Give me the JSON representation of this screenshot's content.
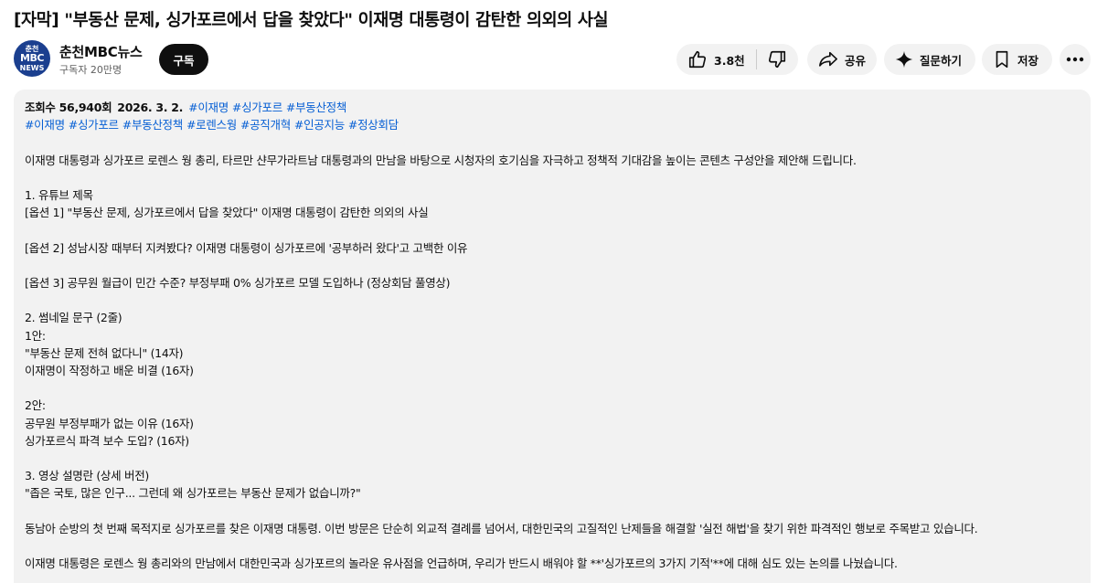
{
  "video": {
    "title": "[자막] \"부동산 문제, 싱가포르에서 답을 찾았다\" 이재명 대통령이 감탄한 의외의 사실"
  },
  "channel": {
    "avatar_top": "춘천",
    "avatar_mid": "MBC",
    "avatar_bottom": "NEWS",
    "name": "춘천MBC뉴스",
    "subscribers": "구독자 20만명",
    "subscribe_label": "구독"
  },
  "actions": {
    "like_count": "3.8천",
    "share_label": "공유",
    "ask_label": "질문하기",
    "save_label": "저장"
  },
  "description": {
    "views": "조회수 56,940회",
    "date": "2026. 3. 2.",
    "title_tags": [
      "#이재명",
      "#싱가포르",
      "#부동산정책"
    ],
    "tags": [
      "#이재명",
      "#싱가포르",
      "#부동산정책",
      "#로렌스웡",
      "#공직개혁",
      "#인공지능",
      "#정상회담"
    ],
    "lines": [
      "이재명 대통령과 싱가포르 로렌스 웡 총리, 타르만 샨무가라트남 대통령과의 만남을 바탕으로 시청자의 호기심을 자극하고 정책적 기대감을 높이는 콘텐츠 구성안을 제안해 드립니다.",
      "",
      "1. 유튜브 제목",
      "[옵션 1] \"부동산 문제, 싱가포르에서 답을 찾았다\" 이재명 대통령이 감탄한 의외의 사실",
      "",
      "[옵션 2] 성남시장 때부터 지켜봤다? 이재명 대통령이 싱가포르에 '공부하러 왔다'고 고백한 이유",
      "",
      "[옵션 3] 공무원 월급이 민간 수준? 부정부패 0% 싱가포르 모델 도입하나 (정상회담 풀영상)",
      "",
      "2. 썸네일 문구 (2줄)",
      "1안:",
      "\"부동산 문제 전혀 없다니\" (14자)",
      "이재명이 작정하고 배운 비결 (16자)",
      "",
      "2안:",
      "공무원 부정부패가 없는 이유 (16자)",
      "싱가포르식 파격 보수 도입? (16자)",
      "",
      "3. 영상 설명란 (상세 버전)",
      "\"좁은 국토, 많은 인구... 그런데 왜 싱가포르는 부동산 문제가 없습니까?\"",
      "",
      "동남아 순방의 첫 번째 목적지로 싱가포르를 찾은 이재명 대통령. 이번 방문은 단순히 외교적 결례를 넘어서, 대한민국의 고질적인 난제들을 해결할 '실전 해법'을 찾기 위한 파격적인 행보로 주목받고 있습니다.",
      "",
      "이재명 대통령은 로렌스 웡 총리와의 만남에서 대한민국과 싱가포르의 놀라운 유사점을 언급하며, 우리가 반드시 배워야 할 **'싱가포르의 3가지 기적'**에 대해 심도 있는 논의를 나눴습니다."
    ]
  }
}
